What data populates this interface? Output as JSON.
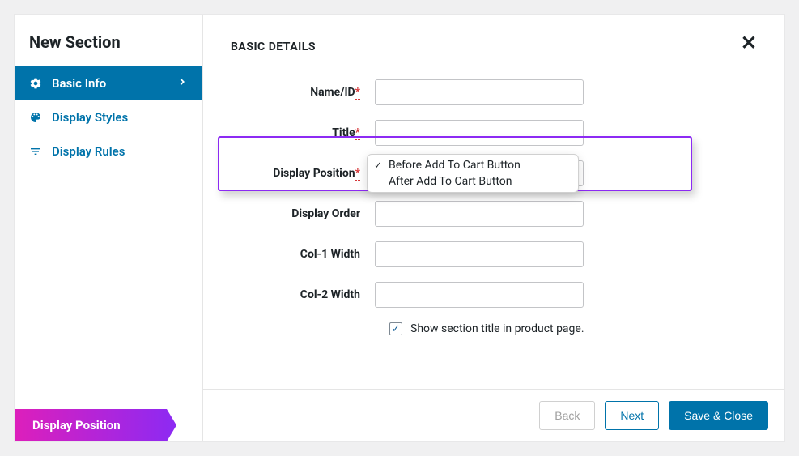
{
  "sidebar": {
    "title": "New Section",
    "tabs": [
      {
        "label": "Basic Info"
      },
      {
        "label": "Display Styles"
      },
      {
        "label": "Display Rules"
      }
    ]
  },
  "header": {
    "title": "BASIC DETAILS"
  },
  "form": {
    "name_id": {
      "label": "Name/ID",
      "value": ""
    },
    "title": {
      "label": "Title",
      "value": ""
    },
    "display_position": {
      "label": "Display Position",
      "options": [
        "Before Add To Cart Button",
        "After Add To Cart Button"
      ],
      "selected_index": 0
    },
    "display_order": {
      "label": "Display Order",
      "value": ""
    },
    "col1_width": {
      "label": "Col-1 Width",
      "value": ""
    },
    "col2_width": {
      "label": "Col-2 Width",
      "value": ""
    },
    "show_title_checkbox": {
      "label": "Show section title in product page.",
      "checked": true
    }
  },
  "footer": {
    "back": "Back",
    "next": "Next",
    "save_close": "Save & Close"
  },
  "tooltip_caption": "Display Position"
}
